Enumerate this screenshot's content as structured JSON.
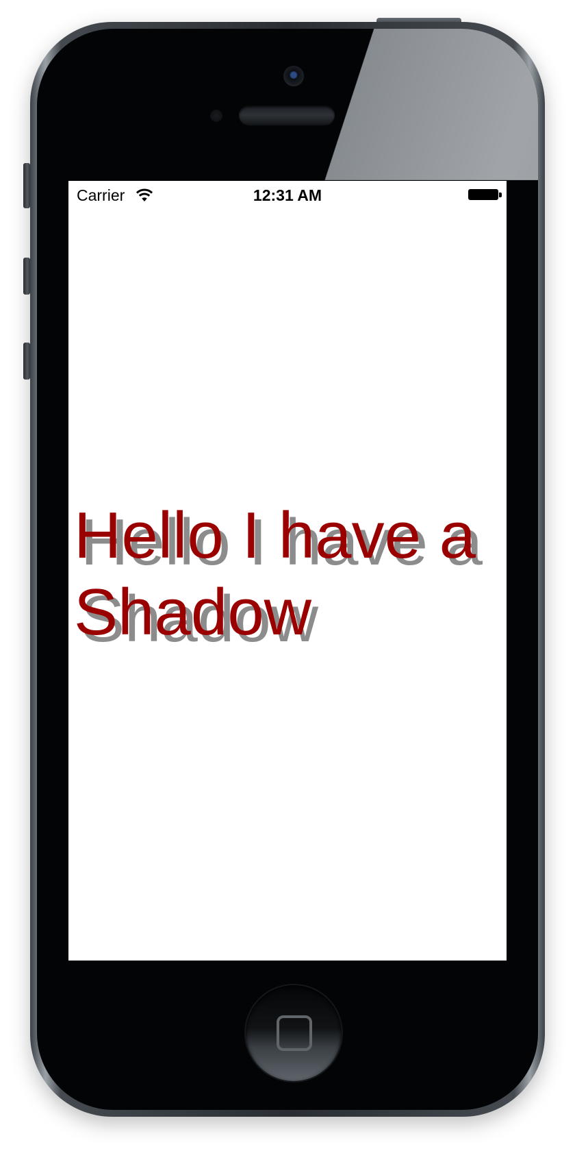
{
  "status_bar": {
    "carrier": "Carrier",
    "time": "12:31 AM"
  },
  "content": {
    "label_text": "Hello I have a Shadow"
  },
  "colors": {
    "label": "#9b0000",
    "shadow": "#8c8c8c",
    "screen_background": "#ffffff"
  },
  "icons": [
    "wifi-icon",
    "battery-icon",
    "home-button-icon"
  ]
}
